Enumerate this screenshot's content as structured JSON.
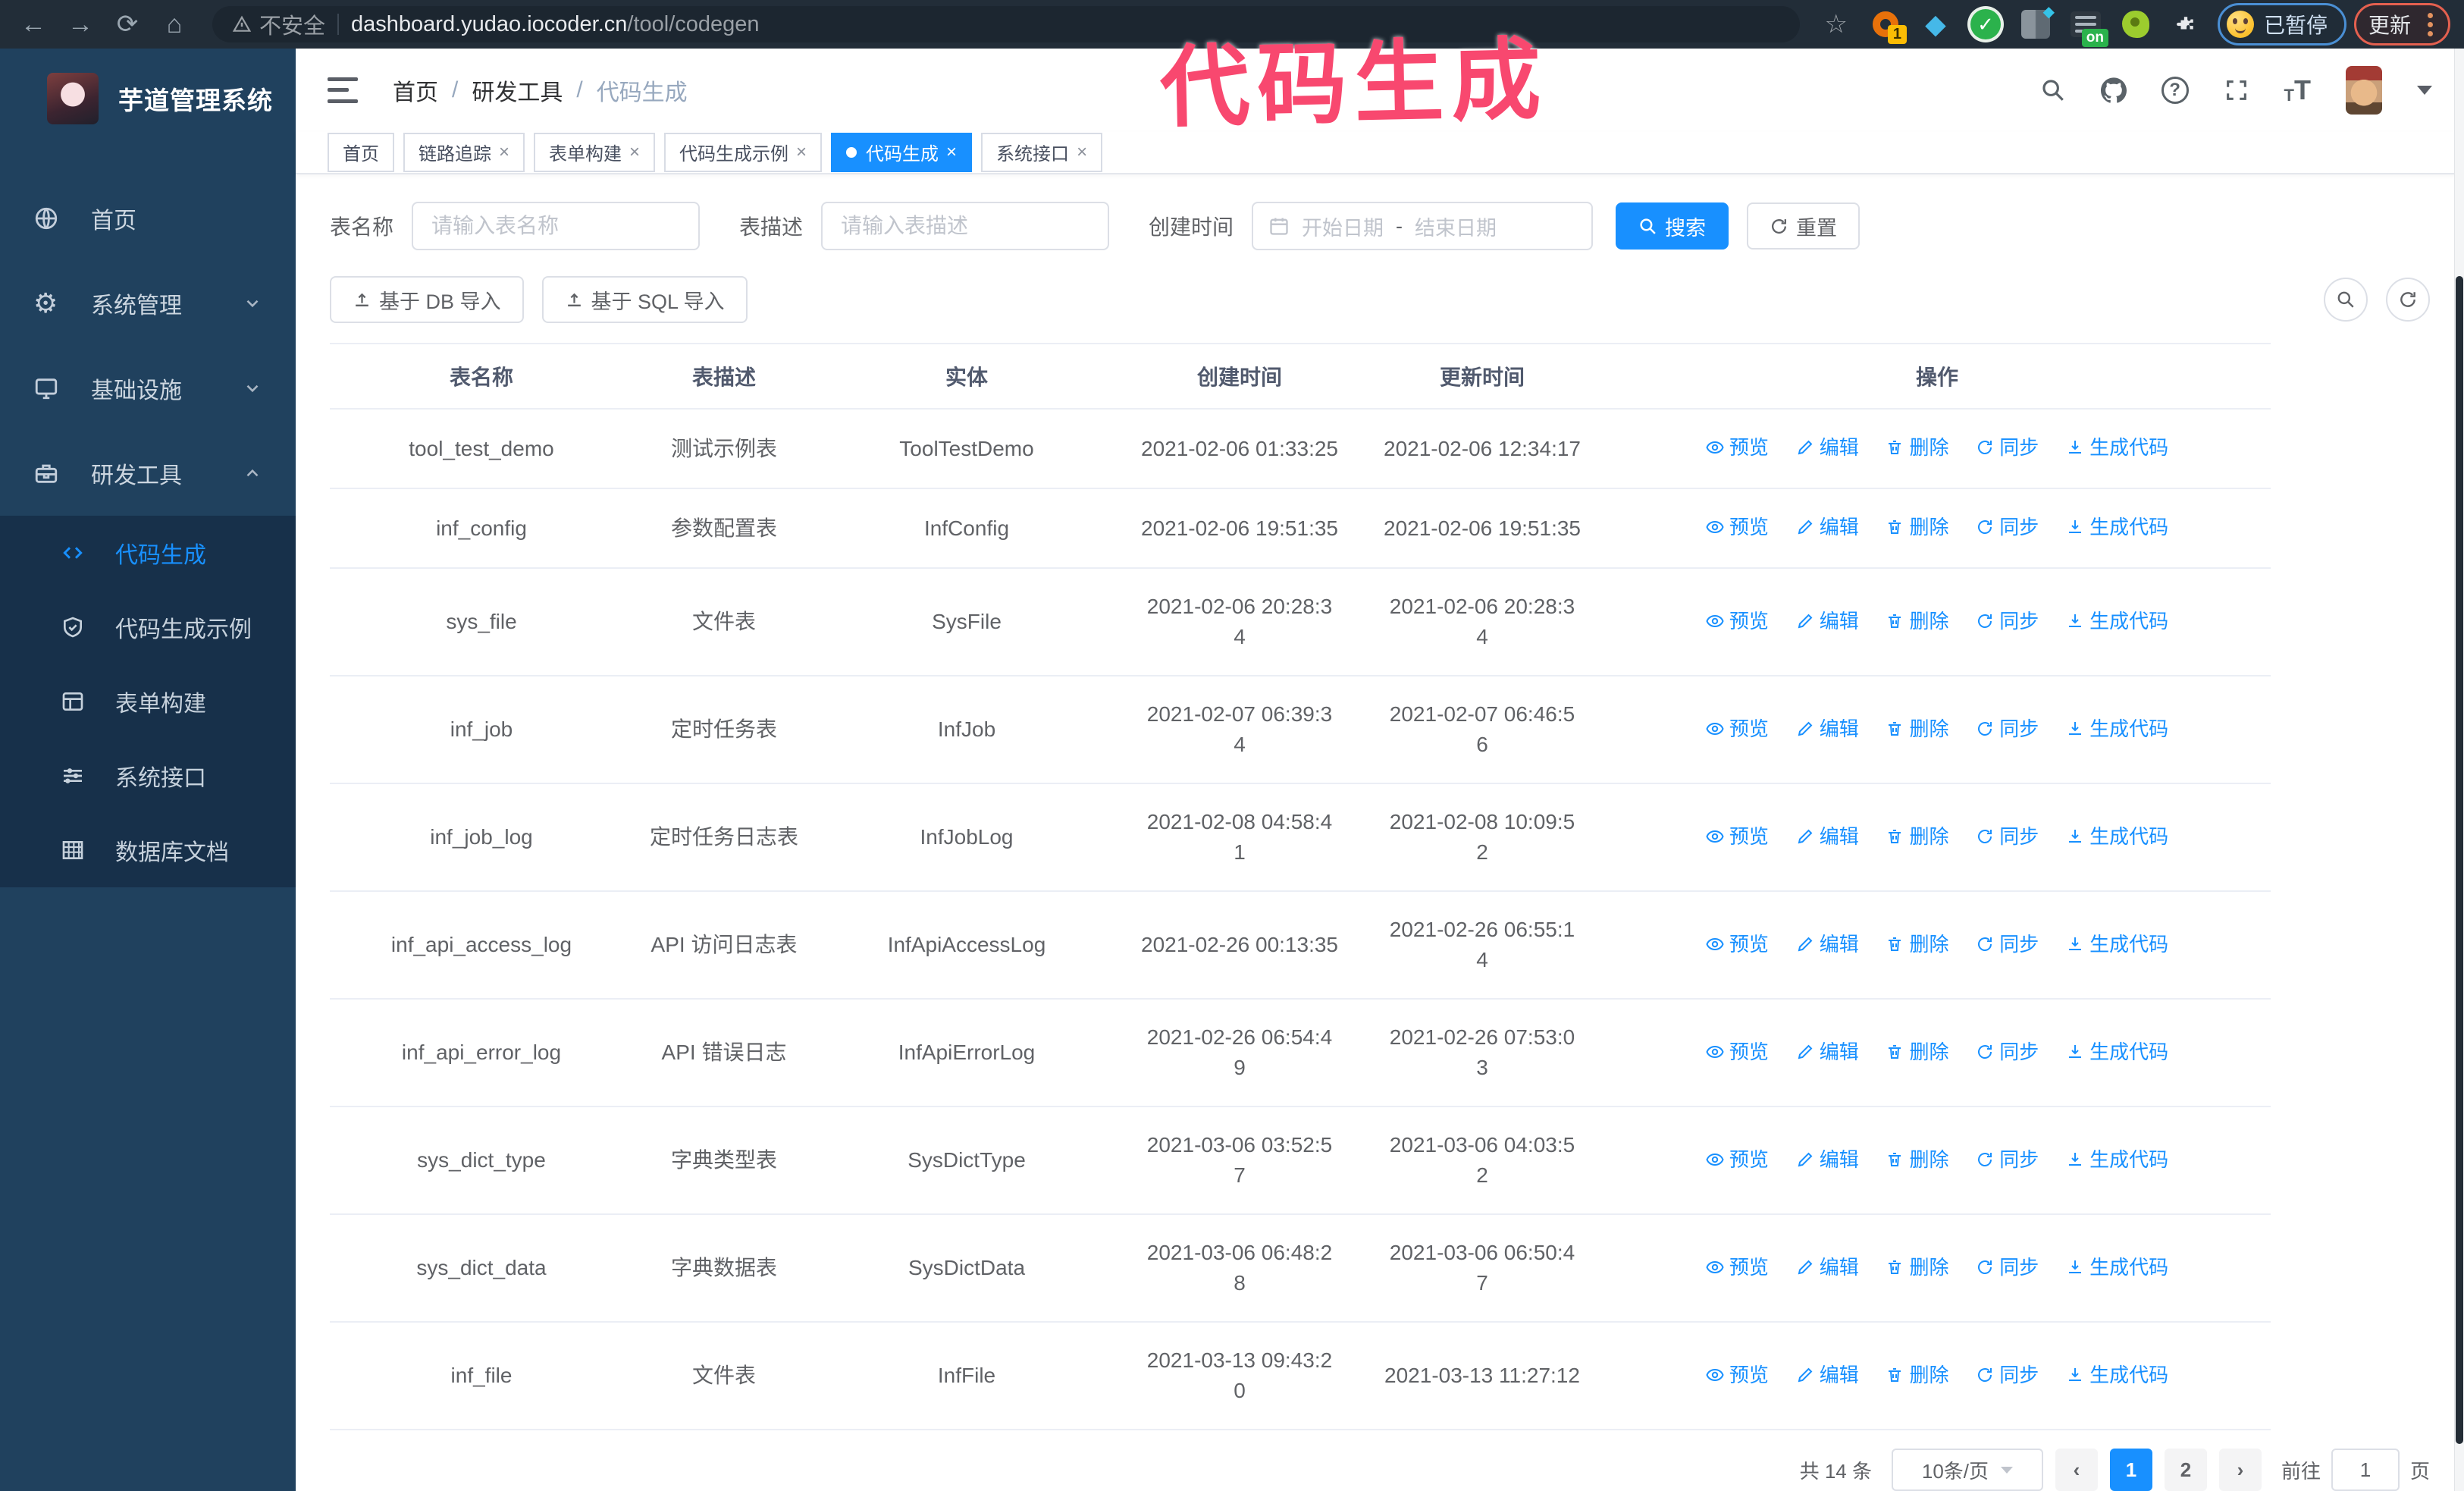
{
  "browser": {
    "security_label": "不安全",
    "url_domain": "dashboard.yudao.iocoder.cn",
    "url_path": "/tool/codegen",
    "ext_badge_count": "1",
    "ext_badge_on": "on",
    "paused_label": "已暂停",
    "update_label": "更新"
  },
  "icons": {
    "back": "←",
    "forward": "→",
    "reload": "⟳",
    "home": "⌂",
    "star": "☆",
    "gem": "◆",
    "check": "✓",
    "gear": "⚙",
    "question": "?",
    "prev_page": "‹",
    "next_page": "›"
  },
  "annotation": {
    "text": "代码生成",
    "color": "#f8486f"
  },
  "sidebar": {
    "title": "芋道管理系统",
    "items": [
      {
        "label": "首页"
      },
      {
        "label": "系统管理"
      },
      {
        "label": "基础设施"
      },
      {
        "label": "研发工具"
      }
    ],
    "submenu": [
      {
        "label": "代码生成"
      },
      {
        "label": "代码生成示例"
      },
      {
        "label": "表单构建"
      },
      {
        "label": "系统接口"
      },
      {
        "label": "数据库文档"
      }
    ]
  },
  "header": {
    "breadcrumb": [
      "首页",
      "研发工具",
      "代码生成"
    ]
  },
  "tabs": [
    {
      "label": "首页"
    },
    {
      "label": "链路追踪"
    },
    {
      "label": "表单构建"
    },
    {
      "label": "代码生成示例"
    },
    {
      "label": "代码生成"
    },
    {
      "label": "系统接口"
    }
  ],
  "filters": {
    "table_name_label": "表名称",
    "table_name_placeholder": "请输入表名称",
    "table_desc_label": "表描述",
    "table_desc_placeholder": "请输入表描述",
    "create_time_label": "创建时间",
    "start_placeholder": "开始日期",
    "range_separator": "-",
    "end_placeholder": "结束日期",
    "search_label": "搜索",
    "reset_label": "重置"
  },
  "toolbar": {
    "import_db_label": "基于 DB 导入",
    "import_sql_label": "基于 SQL 导入"
  },
  "table": {
    "columns": [
      "表名称",
      "表描述",
      "实体",
      "创建时间",
      "更新时间",
      "操作"
    ],
    "actions": {
      "preview": "预览",
      "edit": "编辑",
      "delete": "删除",
      "sync": "同步",
      "generate": "生成代码"
    },
    "rows": [
      {
        "name": "tool_test_demo",
        "desc": "测试示例表",
        "entity": "ToolTestDemo",
        "created": "2021-02-06 01:33:25",
        "updated": "2021-02-06 12:34:17"
      },
      {
        "name": "inf_config",
        "desc": "参数配置表",
        "entity": "InfConfig",
        "created": "2021-02-06 19:51:35",
        "updated": "2021-02-06 19:51:35"
      },
      {
        "name": "sys_file",
        "desc": "文件表",
        "entity": "SysFile",
        "created": "2021-02-06 20:28:3\n4",
        "updated": "2021-02-06 20:28:3\n4"
      },
      {
        "name": "inf_job",
        "desc": "定时任务表",
        "entity": "InfJob",
        "created": "2021-02-07 06:39:3\n4",
        "updated": "2021-02-07 06:46:5\n6"
      },
      {
        "name": "inf_job_log",
        "desc": "定时任务日志表",
        "entity": "InfJobLog",
        "created": "2021-02-08 04:58:4\n1",
        "updated": "2021-02-08 10:09:5\n2"
      },
      {
        "name": "inf_api_access_log",
        "desc": "API 访问日志表",
        "entity": "InfApiAccessLog",
        "created": "2021-02-26 00:13:35",
        "updated": "2021-02-26 06:55:1\n4"
      },
      {
        "name": "inf_api_error_log",
        "desc": "API 错误日志",
        "entity": "InfApiErrorLog",
        "created": "2021-02-26 06:54:4\n9",
        "updated": "2021-02-26 07:53:0\n3"
      },
      {
        "name": "sys_dict_type",
        "desc": "字典类型表",
        "entity": "SysDictType",
        "created": "2021-03-06 03:52:5\n7",
        "updated": "2021-03-06 04:03:5\n2"
      },
      {
        "name": "sys_dict_data",
        "desc": "字典数据表",
        "entity": "SysDictData",
        "created": "2021-03-06 06:48:2\n8",
        "updated": "2021-03-06 06:50:4\n7"
      },
      {
        "name": "inf_file",
        "desc": "文件表",
        "entity": "InfFile",
        "created": "2021-03-13 09:43:2\n0",
        "updated": "2021-03-13 11:27:12"
      }
    ]
  },
  "pagination": {
    "total": "共 14 条",
    "page_size": "10条/页",
    "pages": [
      "1",
      "2"
    ],
    "active_page": "1",
    "goto_label": "前往",
    "goto_value": "1",
    "goto_unit": "页"
  },
  "colors": {
    "accent": "#1890ff",
    "sidebar_bg": "#20415e",
    "submenu_bg": "#17304a",
    "chrome_bg": "#222d38",
    "annotation": "#f8486f"
  }
}
